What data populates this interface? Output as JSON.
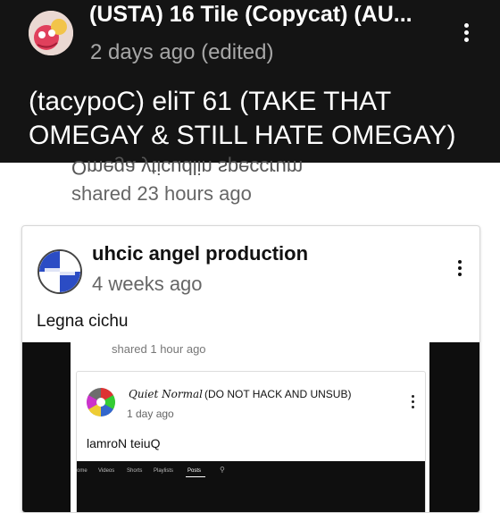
{
  "top_post": {
    "title": "(USTA) 16 Tile (Copycat) (AU...",
    "time": "2 days ago (edited)",
    "text": "(tacypoC) eliT 61 (TAKE THAT OMEGAY & STILL HATE OMEGAY)"
  },
  "mirrored_text": "Omega yticudlin speccrum",
  "shared_time": "shared 23 hours ago",
  "card": {
    "author": "uhcic angel production",
    "time": "4 weeks ago",
    "text": "Legna cichu",
    "inner_shared_time": "shared 1 hour ago",
    "inner_post": {
      "name_script": "Quiet Normal",
      "name": "(DO NOT HACK AND UNSUB)",
      "time": "1 day ago",
      "text": "lamroN teiuQ"
    },
    "tabs": [
      "ome",
      "Videos",
      "Shorts",
      "Playlists",
      "Posts"
    ],
    "active_tab": "Posts"
  },
  "icons": [
    "more-vert-icon",
    "search-icon"
  ],
  "colors": {
    "header_bg": "#141414",
    "card_bg": "#ffffff",
    "dark_area": "#0e0e0e"
  }
}
